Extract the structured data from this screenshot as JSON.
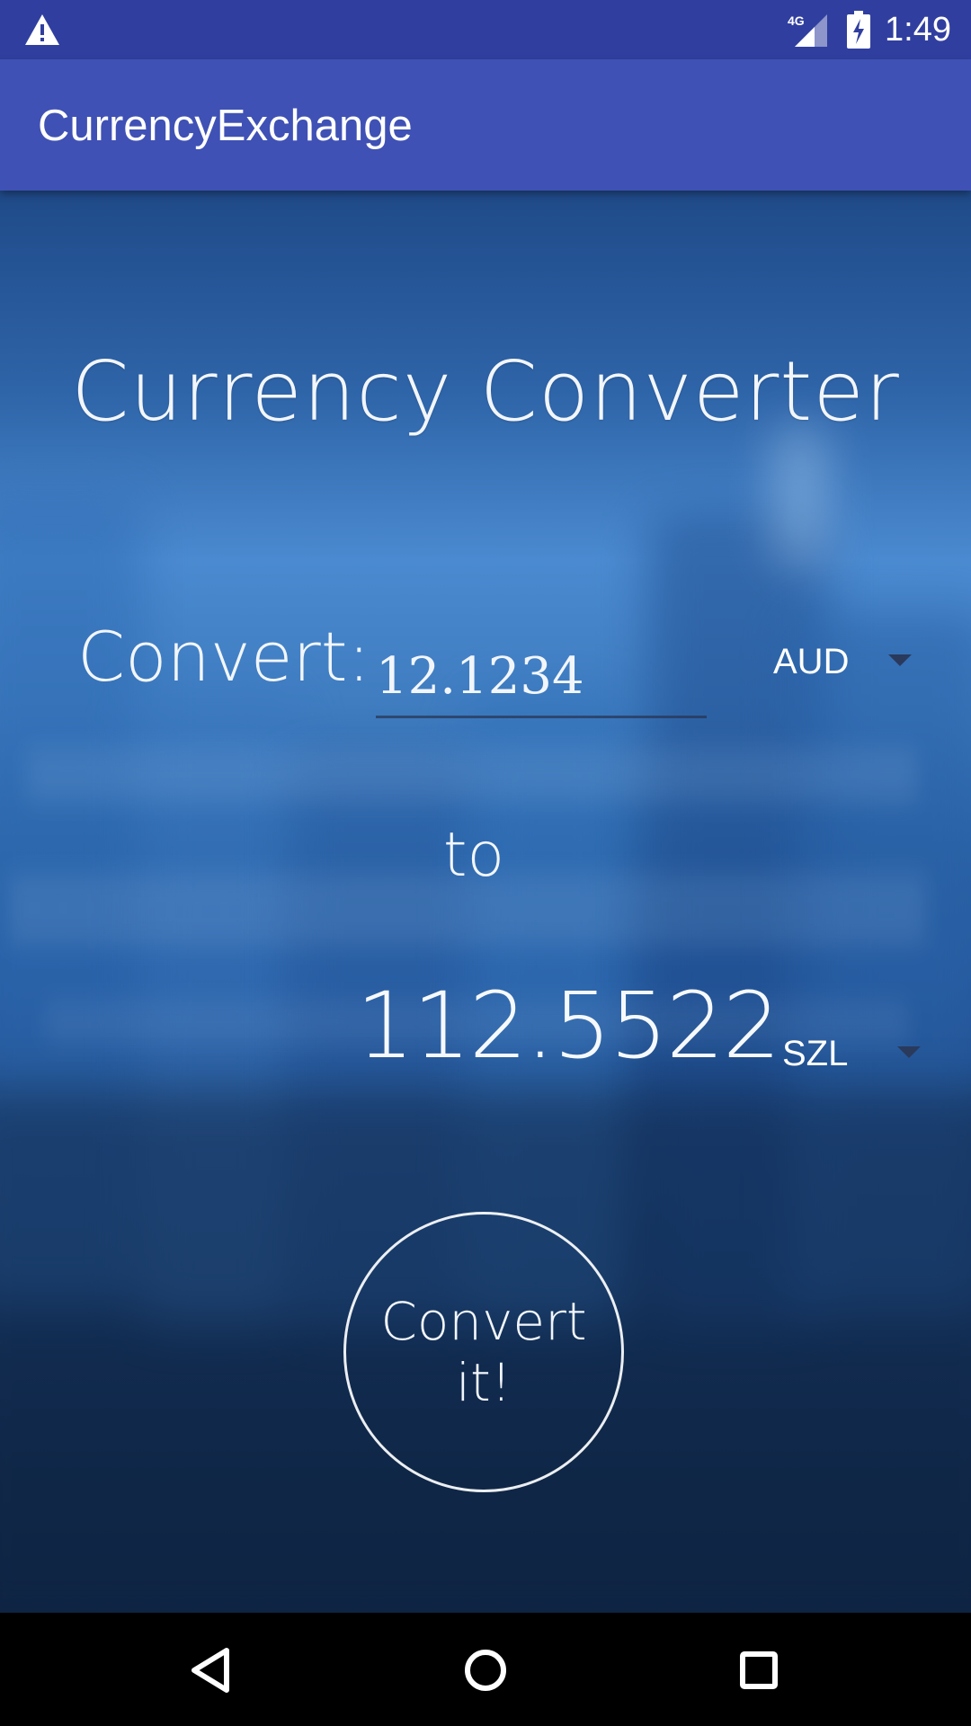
{
  "status_bar": {
    "time": "1:49",
    "network": "4G",
    "icons": [
      "warning-icon",
      "cell-signal-icon",
      "battery-charging-icon"
    ]
  },
  "app_bar": {
    "title": "CurrencyExchange"
  },
  "converter": {
    "heading": "Currency Converter",
    "convert_label": "Convert:",
    "amount_value": "12.1234",
    "from_currency": "AUD",
    "to_label": "to",
    "result_value": "112.5522",
    "to_currency": "SZL",
    "convert_button_label": "Convert it!"
  },
  "nav_bar": {
    "icons": [
      "back-icon",
      "home-icon",
      "recents-icon"
    ]
  },
  "colors": {
    "status_bar": "#303f9f",
    "app_bar": "#3f51b5",
    "text_light": "#f2f6fb"
  }
}
